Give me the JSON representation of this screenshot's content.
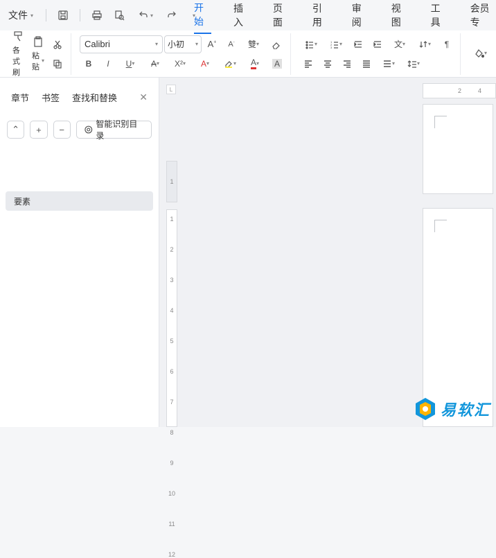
{
  "quick_access": {
    "file_label": "文件",
    "icons": [
      "save-icon",
      "print-icon",
      "print-preview-icon",
      "undo-icon",
      "redo-icon"
    ]
  },
  "menu": {
    "tabs": [
      "开始",
      "插入",
      "页面",
      "引用",
      "审阅",
      "视图",
      "工具",
      "会员专"
    ],
    "active_index": 0
  },
  "ribbon": {
    "format_painter": "各式刷",
    "paste": "粘贴",
    "font_name": "Calibri",
    "font_size": "小初"
  },
  "sidebar": {
    "tabs": [
      "章节",
      "书签",
      "查找和替换"
    ],
    "smart_toc": "智能识别目录",
    "element_label": "要素"
  },
  "ruler": {
    "h_values": [
      "2",
      "4"
    ],
    "corner": "L",
    "v_top": "1",
    "v_values": [
      "1",
      "2",
      "3",
      "4",
      "5",
      "6",
      "7",
      "8",
      "9",
      "10",
      "11",
      "12"
    ]
  },
  "watermark": {
    "text": "易软汇"
  }
}
